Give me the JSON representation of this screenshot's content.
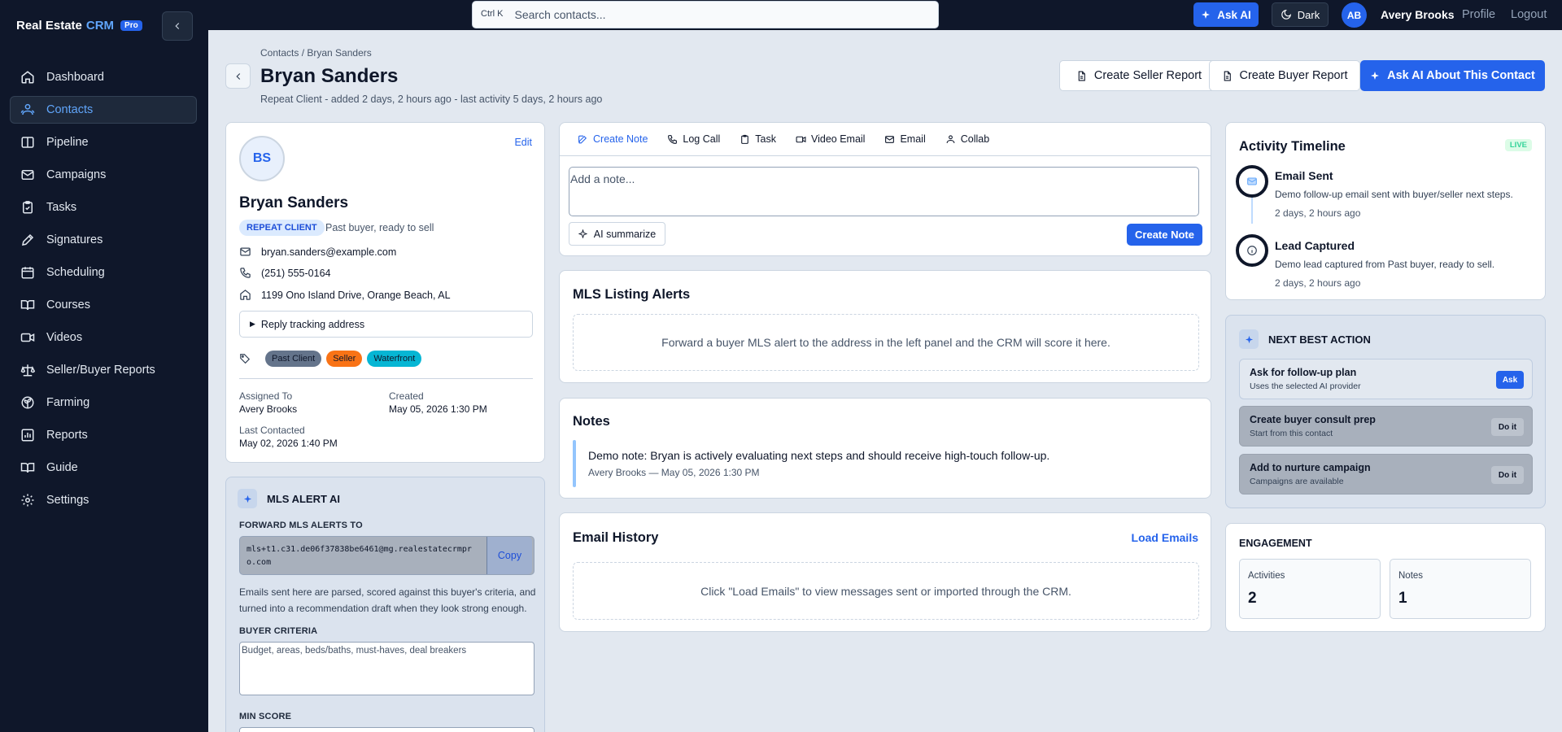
{
  "brand": {
    "name": "Real Estate",
    "crm": "CRM",
    "badge": "Pro"
  },
  "sidebar": {
    "items": [
      {
        "label": "Dashboard",
        "icon": "home-icon",
        "active": false
      },
      {
        "label": "Contacts",
        "icon": "users-icon",
        "active": true
      },
      {
        "label": "Pipeline",
        "icon": "columns-icon",
        "active": false
      },
      {
        "label": "Campaigns",
        "icon": "mail-icon",
        "active": false
      },
      {
        "label": "Tasks",
        "icon": "clipboard-check-icon",
        "active": false
      },
      {
        "label": "Signatures",
        "icon": "pen-icon",
        "active": false
      },
      {
        "label": "Scheduling",
        "icon": "calendar-icon",
        "active": false
      },
      {
        "label": "Courses",
        "icon": "book-icon",
        "active": false
      },
      {
        "label": "Videos",
        "icon": "video-icon",
        "active": false
      },
      {
        "label": "Seller/Buyer Reports",
        "icon": "scale-icon",
        "active": false
      },
      {
        "label": "Farming",
        "icon": "sprout-icon",
        "active": false
      },
      {
        "label": "Reports",
        "icon": "bar-chart-icon",
        "active": false
      },
      {
        "label": "Guide",
        "icon": "book-open-icon",
        "active": false
      },
      {
        "label": "Settings",
        "icon": "gear-icon",
        "active": false
      }
    ]
  },
  "topbar": {
    "shortcut": "Ctrl K",
    "search_placeholder": "Search contacts...",
    "ask_ai": "Ask AI",
    "dark": "Dark",
    "user_initials": "AB",
    "user_name": "Avery Brooks",
    "profile": "Profile",
    "logout": "Logout"
  },
  "header": {
    "breadcrumb": "Contacts / Bryan Sanders",
    "title": "Bryan Sanders",
    "subtitle": "Repeat Client - added 2 days, 2 hours ago - last activity 5 days, 2 hours ago",
    "seller_report": "Create Seller Report",
    "buyer_report": "Create Buyer Report",
    "ask_ai_contact": "Ask AI About This Contact"
  },
  "contact": {
    "initials": "BS",
    "edit": "Edit",
    "name": "Bryan Sanders",
    "badge": "REPEAT CLIENT",
    "badge_desc": "Past buyer, ready to sell",
    "email": "bryan.sanders@example.com",
    "phone": "(251) 555-0164",
    "address": "1199 Ono Island Drive, Orange Beach, AL",
    "reply_tracking": "Reply tracking address",
    "tags": [
      {
        "label": "Past Client",
        "color": "#64748b"
      },
      {
        "label": "Seller",
        "color": "#f97316"
      },
      {
        "label": "Waterfront",
        "color": "#06b6d4"
      }
    ],
    "assigned_label": "Assigned To",
    "assigned_value": "Avery Brooks",
    "created_label": "Created",
    "created_value": "May 05, 2026 1:30 PM",
    "last_contacted_label": "Last Contacted",
    "last_contacted_value": "May 02, 2026 1:40 PM"
  },
  "mls_ai": {
    "title": "MLS ALERT AI",
    "forward_label": "FORWARD MLS ALERTS TO",
    "address": "mls+t1.c31.de06f37838be6461@mg.realestatecrmpro.com",
    "copy": "Copy",
    "help": "Emails sent here are parsed, scored against this buyer's criteria, and turned into a recommendation draft when they look strong enough.",
    "criteria_label": "BUYER CRITERIA",
    "criteria_placeholder": "Budget, areas, beds/baths, must-haves, deal breakers",
    "min_score_label": "MIN SCORE"
  },
  "composer": {
    "tabs": [
      {
        "label": "Create Note",
        "icon": "edit-icon",
        "active": true
      },
      {
        "label": "Log Call",
        "icon": "phone-icon",
        "active": false
      },
      {
        "label": "Task",
        "icon": "clipboard-icon",
        "active": false
      },
      {
        "label": "Video Email",
        "icon": "video-icon",
        "active": false
      },
      {
        "label": "Email",
        "icon": "mail-icon",
        "active": false
      },
      {
        "label": "Collab",
        "icon": "users-icon",
        "active": false
      }
    ],
    "placeholder": "Add a note...",
    "ai_summarize": "AI summarize",
    "create_note": "Create Note"
  },
  "mls_alerts": {
    "title": "MLS Listing Alerts",
    "empty": "Forward a buyer MLS alert to the address in the left panel and the CRM will score it here."
  },
  "notes": {
    "title": "Notes",
    "items": [
      {
        "text": "Demo note: Bryan is actively evaluating next steps and should receive high-touch follow-up.",
        "meta": "Avery Brooks — May 05, 2026 1:30 PM"
      }
    ]
  },
  "email_history": {
    "title": "Email History",
    "load": "Load Emails",
    "empty": "Click \"Load Emails\" to view messages sent or imported through the CRM."
  },
  "timeline": {
    "title": "Activity Timeline",
    "live": "LIVE",
    "items": [
      {
        "title": "Email Sent",
        "desc": "Demo follow-up email sent with buyer/seller next steps.",
        "time": "2 days, 2 hours ago",
        "icon": "mail-icon"
      },
      {
        "title": "Lead Captured",
        "desc": "Demo lead captured from Past buyer, ready to sell.",
        "time": "2 days, 2 hours ago",
        "icon": "info-icon"
      }
    ]
  },
  "nba": {
    "title": "NEXT BEST ACTION",
    "items": [
      {
        "title": "Ask for follow-up plan",
        "sub": "Uses the selected AI provider",
        "btn": "Ask"
      },
      {
        "title": "Create buyer consult prep",
        "sub": "Start from this contact",
        "btn": "Do it"
      },
      {
        "title": "Add to nurture campaign",
        "sub": "Campaigns are available",
        "btn": "Do it"
      }
    ]
  },
  "engagement": {
    "title": "ENGAGEMENT",
    "activities_label": "Activities",
    "activities_value": "2",
    "notes_label": "Notes",
    "notes_value": "1"
  }
}
